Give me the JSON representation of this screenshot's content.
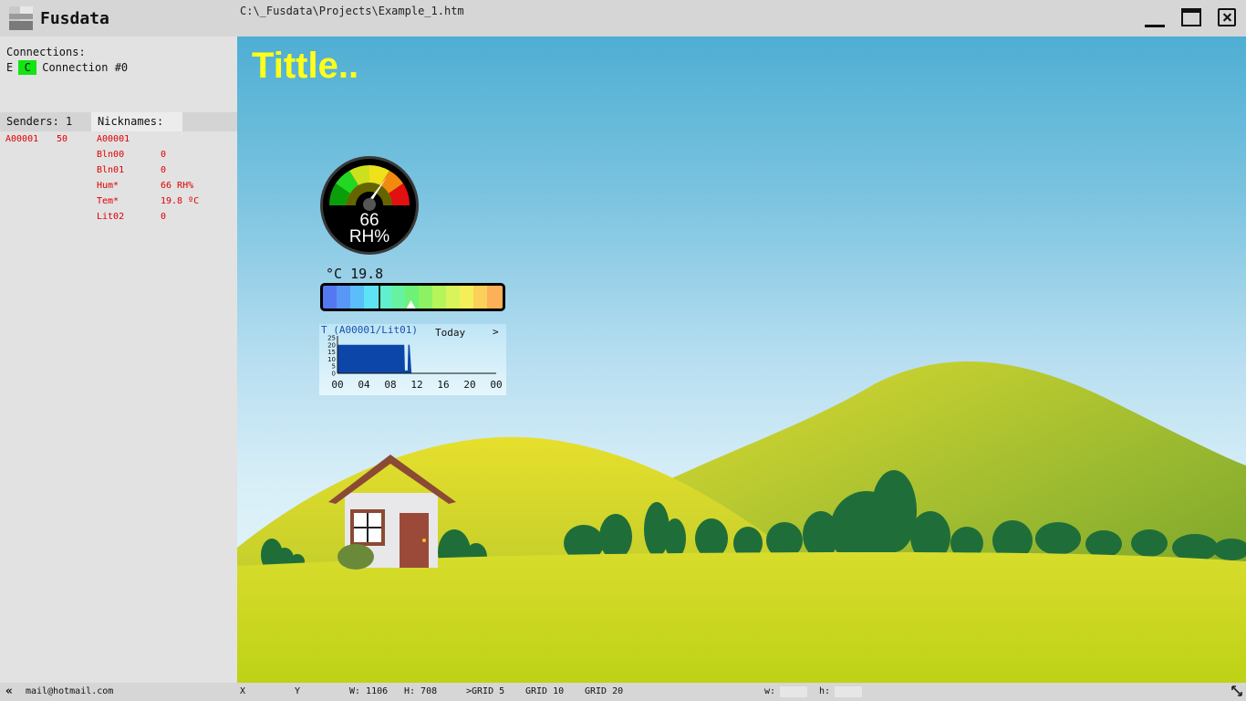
{
  "app": {
    "name": "Fusdata",
    "file_path": "C:\\_Fusdata\\Projects\\Example_1.htm"
  },
  "connections": {
    "label": "Connections:",
    "items": [
      {
        "e": "E",
        "c": "C",
        "name": "Connection #0",
        "status_color": "#13e413"
      }
    ]
  },
  "tabs": {
    "senders": "Senders: 1",
    "nicknames": "Nicknames:"
  },
  "senders": [
    {
      "id": "A00001",
      "value": "50"
    }
  ],
  "nicknames": [
    {
      "name": "A00001",
      "value": ""
    },
    {
      "name": "Bln00",
      "value": "0"
    },
    {
      "name": "Bln01",
      "value": "0"
    },
    {
      "name": "Hum*",
      "value": "66 RH%"
    },
    {
      "name": "Tem*",
      "value": "19.8 ºC"
    },
    {
      "name": "Lit02",
      "value": "0"
    }
  ],
  "canvas": {
    "title": "Tittle.."
  },
  "gauge": {
    "value": "66",
    "unit": "RH%",
    "min": 0,
    "max": 100,
    "level": 66
  },
  "colorbar": {
    "unit": "°C",
    "value": "19.8",
    "level": 0.49
  },
  "minichart": {
    "title": "T (A00001/Lit01)",
    "period": "Today",
    "next": ">",
    "y_ticks": [
      "25",
      "20",
      "15",
      "10",
      "5",
      "0"
    ],
    "x_ticks": [
      "00",
      "04",
      "08",
      "12",
      "16",
      "20",
      "00"
    ]
  },
  "chart_data": {
    "type": "area",
    "title": "T (A00001/Lit01)",
    "xlabel": "",
    "ylabel": "",
    "ylim": [
      0,
      25
    ],
    "x": [
      0,
      0.1,
      10.1,
      10.2,
      10.6,
      10.7,
      10.9,
      11.2
    ],
    "values": [
      20,
      20,
      20,
      2,
      2,
      20,
      20,
      0
    ],
    "series": [
      {
        "values": [
          20,
          20,
          20,
          2,
          2,
          20,
          20,
          0
        ]
      }
    ],
    "x_ticks": [
      "00",
      "04",
      "08",
      "12",
      "16",
      "20",
      "00"
    ],
    "y_ticks": [
      "25",
      "20",
      "15",
      "10",
      "5",
      "0"
    ]
  },
  "statusbar": {
    "email": "mail@hotmail.com",
    "x_label": "X",
    "y_label": "Y",
    "w": "W: 1106",
    "h": "H: 708",
    "grid5": ">GRID 5",
    "grid10": "GRID 10",
    "grid20": "GRID 20",
    "w_small": "w:",
    "h_small": "h:"
  }
}
